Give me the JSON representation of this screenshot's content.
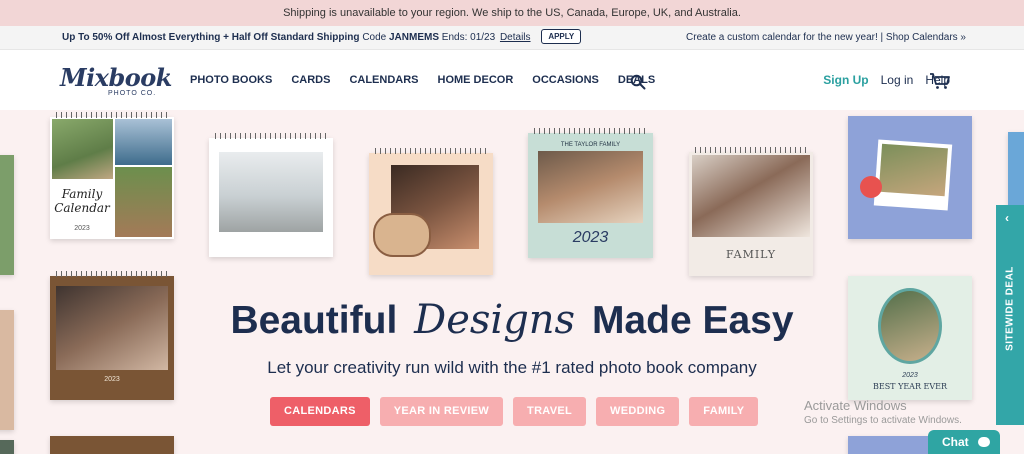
{
  "shipping_notice": "Shipping is unavailable to your region. We ship to the US, Canada, Europe, UK, and Australia.",
  "promo": {
    "offer": "Up To 50% Off Almost Everything + Half Off Standard Shipping",
    "code_label": "Code",
    "code": "JANMEMS",
    "ends": "Ends: 01/23",
    "details": "Details",
    "apply": "APPLY",
    "right_text": "Create a custom calendar for the new year! | Shop Calendars »"
  },
  "nav": {
    "logo": "Mixbook",
    "logo_sub": "PHOTO CO.",
    "links": [
      "PHOTO BOOKS",
      "CARDS",
      "CALENDARS",
      "HOME DECOR",
      "OCCASIONS",
      "DEALS"
    ],
    "sign_up": "Sign Up",
    "log_in": "Log in",
    "help": "Help"
  },
  "hero": {
    "headline_1": "Beautiful",
    "headline_script": "Designs",
    "headline_2": "Made Easy",
    "subhead": "Let your creativity run wild with the #1 rated photo book company",
    "pills": [
      "CALENDARS",
      "YEAR IN REVIEW",
      "TRAVEL",
      "WEDDING",
      "FAMILY"
    ],
    "calendar_texts": {
      "family": "Family Calendar",
      "year1": "2023",
      "taylor": "THE TAYLOR FAMILY",
      "year2": "2023",
      "family2": "FAMILY",
      "best_year": "BEST YEAR EVER",
      "year3": "2023",
      "year4": "2023"
    }
  },
  "windows": {
    "line1": "Activate Windows",
    "line2": "Go to Settings to activate Windows."
  },
  "sitewide": "SITEWIDE DEAL",
  "chat": "Chat",
  "colors": {
    "accent": "#ee5f68",
    "teal": "#2ba0a0",
    "navy": "#1d2e4f"
  }
}
